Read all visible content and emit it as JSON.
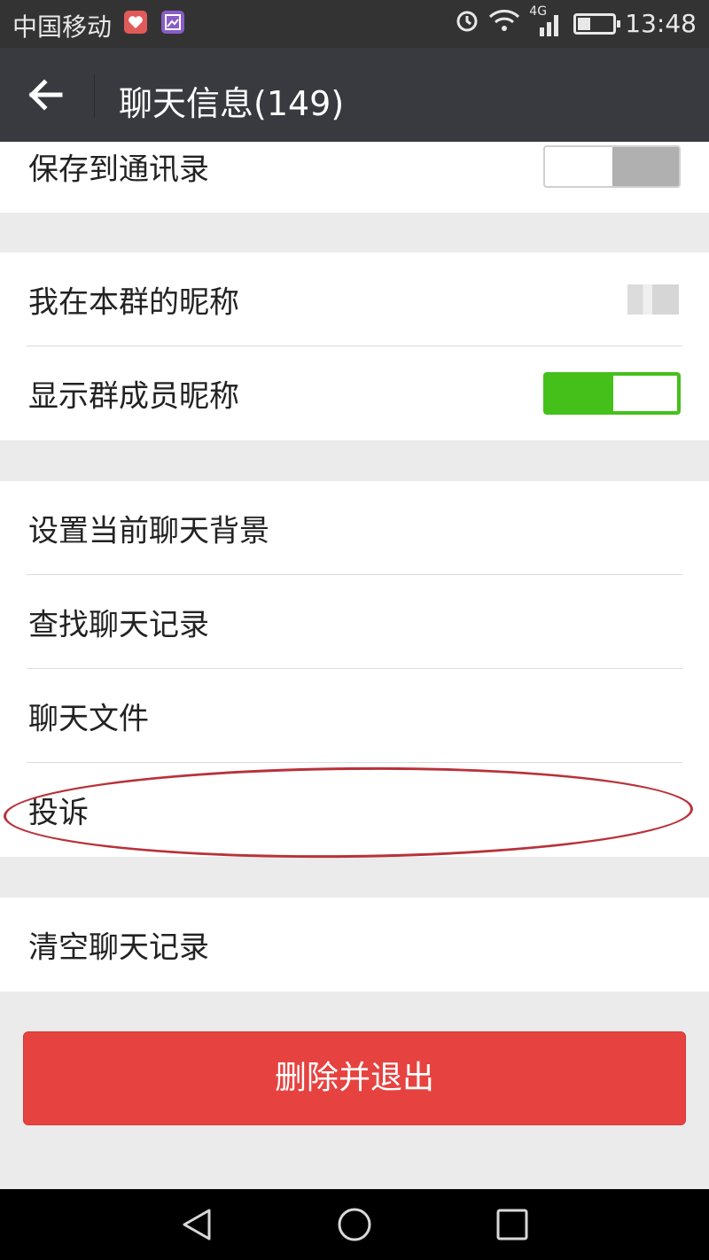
{
  "status_bar": {
    "carrier": "中国移动",
    "network": "4G",
    "time": "13:48",
    "battery_level": 0.35,
    "icons": [
      "heart-app-icon",
      "photo-app-icon",
      "alarm-icon",
      "wifi-icon",
      "signal-icon",
      "battery-icon"
    ]
  },
  "header": {
    "title": "聊天信息(149)",
    "back_icon": "arrow-left-icon"
  },
  "settings": {
    "save_to_contacts": {
      "label": "保存到通讯录",
      "enabled": false
    },
    "my_group_nickname": {
      "label": "我在本群的昵称"
    },
    "show_member_nicknames": {
      "label": "显示群成员昵称",
      "enabled": true
    },
    "set_chat_background": {
      "label": "设置当前聊天背景"
    },
    "search_chat_history": {
      "label": "查找聊天记录"
    },
    "chat_files": {
      "label": "聊天文件"
    },
    "complain": {
      "label": "投诉"
    },
    "clear_chat_history": {
      "label": "清空聊天记录"
    }
  },
  "delete_and_exit": {
    "label": "删除并退出"
  },
  "colors": {
    "titlebar": "#393a3f",
    "toggle_on": "#45c01a",
    "danger": "#e64340",
    "highlight_circle": "#b8323a"
  },
  "nav_bar": {
    "icons": [
      "back-triangle-icon",
      "home-circle-icon",
      "recents-square-icon"
    ]
  }
}
